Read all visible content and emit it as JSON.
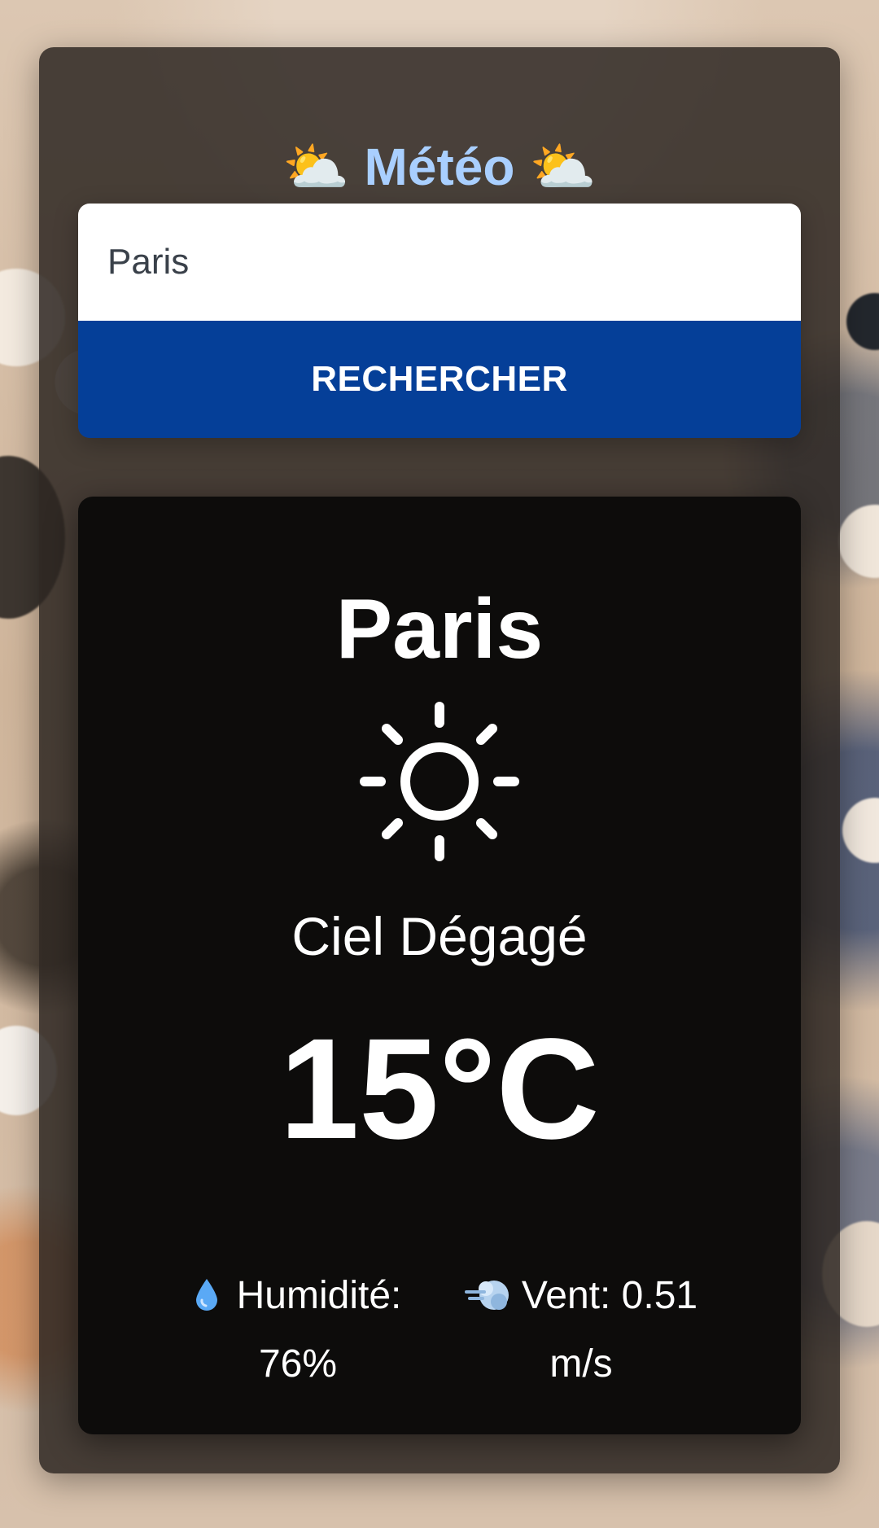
{
  "header": {
    "title": "Météo",
    "title_icon_left": "sun-behind-cloud",
    "title_icon_right": "sun-behind-cloud"
  },
  "search": {
    "value": "Paris",
    "placeholder": "",
    "button_label": "RECHERCHER"
  },
  "weather": {
    "city": "Paris",
    "condition_icon": "sun-icon",
    "condition": "Ciel Dégagé",
    "temperature": "15°C",
    "humidity_label": "Humidité:",
    "humidity_value": "76%",
    "wind_label": "Vent:",
    "wind_value": "0.51",
    "wind_unit": "m/s"
  },
  "colors": {
    "title": "#a9cfff",
    "button": "#053f98",
    "panel": "#0d0c0b",
    "card": "#2e2823"
  }
}
